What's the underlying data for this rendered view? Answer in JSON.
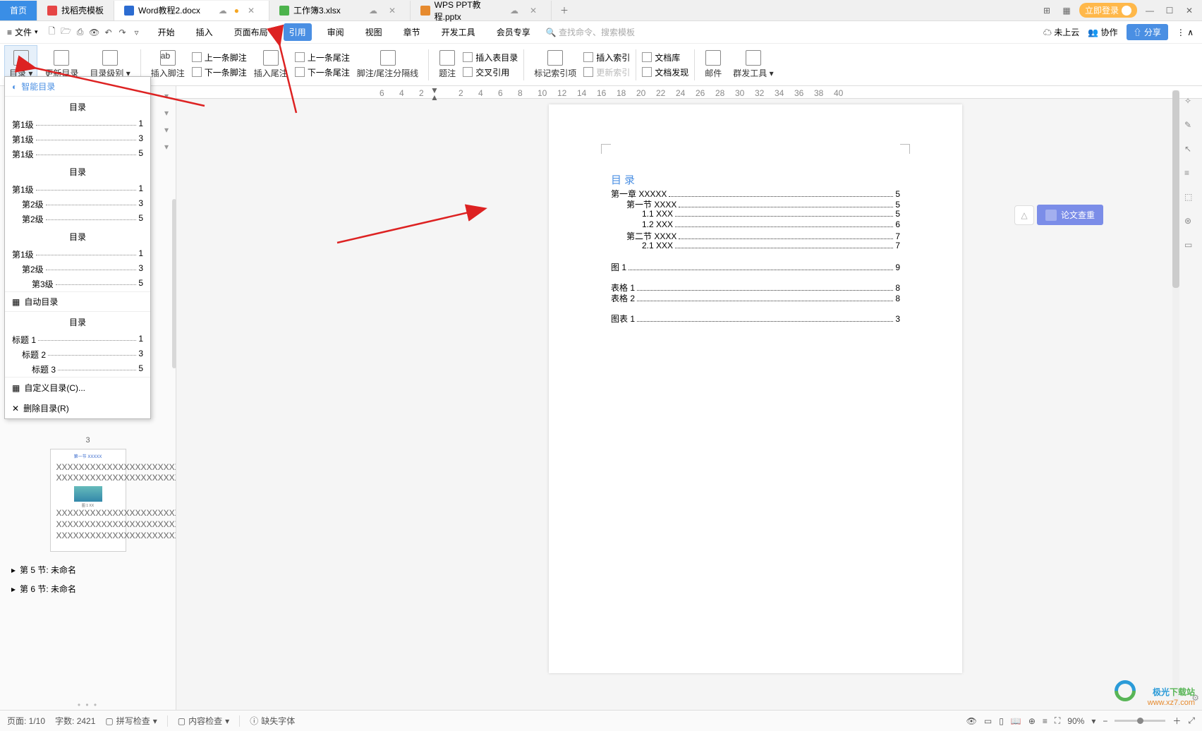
{
  "tabs": {
    "home": "首页",
    "items": [
      {
        "icon": "ico-red",
        "label": "找稻壳模板"
      },
      {
        "icon": "ico-blue",
        "label": "Word教程2.docx",
        "active": true,
        "dirty": true
      },
      {
        "icon": "ico-green",
        "label": "工作簿3.xlsx"
      },
      {
        "icon": "ico-orange",
        "label": "WPS PPT教程.pptx"
      }
    ]
  },
  "title_right": {
    "login": "立即登录"
  },
  "file_menu": "文件",
  "ribbon_tabs": [
    "开始",
    "插入",
    "页面布局",
    "引用",
    "审阅",
    "视图",
    "章节",
    "开发工具",
    "会员专享"
  ],
  "ribbon_active": "引用",
  "search_placeholder": "查找命令、搜索模板",
  "cloud": {
    "not_uploaded": "未上云",
    "collab": "协作",
    "share": "分享"
  },
  "ribbon_groups": {
    "toc": "目录",
    "update_toc": "更新目录",
    "toc_level": "目录级别",
    "insert_footnote": "插入脚注",
    "prev_footnote": "上一条脚注",
    "next_footnote": "下一条脚注",
    "insert_endnote": "插入尾注",
    "prev_endnote": "上一条尾注",
    "next_endnote": "下一条尾注",
    "sep_line": "脚注/尾注分隔线",
    "caption": "题注",
    "cross_ref": "交叉引用",
    "insert_fig_toc": "插入表目录",
    "mark_index": "标记索引项",
    "insert_index": "插入索引",
    "update_index": "更新索引",
    "doc_lib": "文档库",
    "doc_find": "文档发现",
    "mail": "邮件",
    "mass_tool": "群发工具"
  },
  "dropdown": {
    "smart_toc": "智能目录",
    "auto_toc": "自动目录",
    "section_title": "目录",
    "sec1": [
      {
        "label": "第1级",
        "page": "1"
      },
      {
        "label": "第1级",
        "page": "3"
      },
      {
        "label": "第1级",
        "page": "5"
      }
    ],
    "sec2": [
      {
        "label": "第1级",
        "page": "1",
        "indent": 0
      },
      {
        "label": "第2级",
        "page": "3",
        "indent": 1
      },
      {
        "label": "第2级",
        "page": "5",
        "indent": 1
      }
    ],
    "sec3": [
      {
        "label": "第1级",
        "page": "1",
        "indent": 0
      },
      {
        "label": "第2级",
        "page": "3",
        "indent": 1
      },
      {
        "label": "第3级",
        "page": "5",
        "indent": 2
      }
    ],
    "sec4": [
      {
        "label": "标题 1",
        "page": "1",
        "indent": 0
      },
      {
        "label": "标题 2",
        "page": "3",
        "indent": 1
      },
      {
        "label": "标题 3",
        "page": "5",
        "indent": 2
      }
    ],
    "custom": "自定义目录(C)...",
    "remove": "删除目录(R)"
  },
  "nav": {
    "page_num": "3",
    "items": [
      "第 5 节: 未命名",
      "第 6 节: 未命名"
    ]
  },
  "ruler_marks": [
    "6",
    "4",
    "2",
    "",
    "2",
    "4",
    "6",
    "8",
    "10",
    "12",
    "14",
    "16",
    "18",
    "20",
    "22",
    "24",
    "26",
    "28",
    "30",
    "32",
    "34",
    "36",
    "38",
    "40"
  ],
  "doc": {
    "toc_title": "目录",
    "lines": [
      {
        "txt": "第一章  XXXXX",
        "pg": "5",
        "indent": 0
      },
      {
        "txt": "第一节  XXXX",
        "pg": "5",
        "indent": 1
      },
      {
        "txt": "1.1 XXX",
        "pg": "5",
        "indent": 2
      },
      {
        "txt": "1.2 XXX",
        "pg": "6",
        "indent": 2
      },
      {
        "txt": "第二节  XXXX",
        "pg": "7",
        "indent": 1
      },
      {
        "txt": "2.1 XXX",
        "pg": "7",
        "indent": 2
      }
    ],
    "figs": [
      {
        "txt": "图  1",
        "pg": "9"
      }
    ],
    "tables": [
      {
        "txt": "表格  1",
        "pg": "8"
      },
      {
        "txt": "表格  2",
        "pg": "8"
      }
    ],
    "charts": [
      {
        "txt": "图表  1",
        "pg": "3"
      }
    ]
  },
  "float_label": "论文查重",
  "status": {
    "page": "页面: 1/10",
    "words": "字数: 2421",
    "spell": "拼写检查",
    "content": "内容检查",
    "missing_font": "缺失字体",
    "zoom": "90%"
  },
  "watermark": {
    "line1a": "极光",
    "line1b": "下载站",
    "line2": "www.xz7.com"
  }
}
